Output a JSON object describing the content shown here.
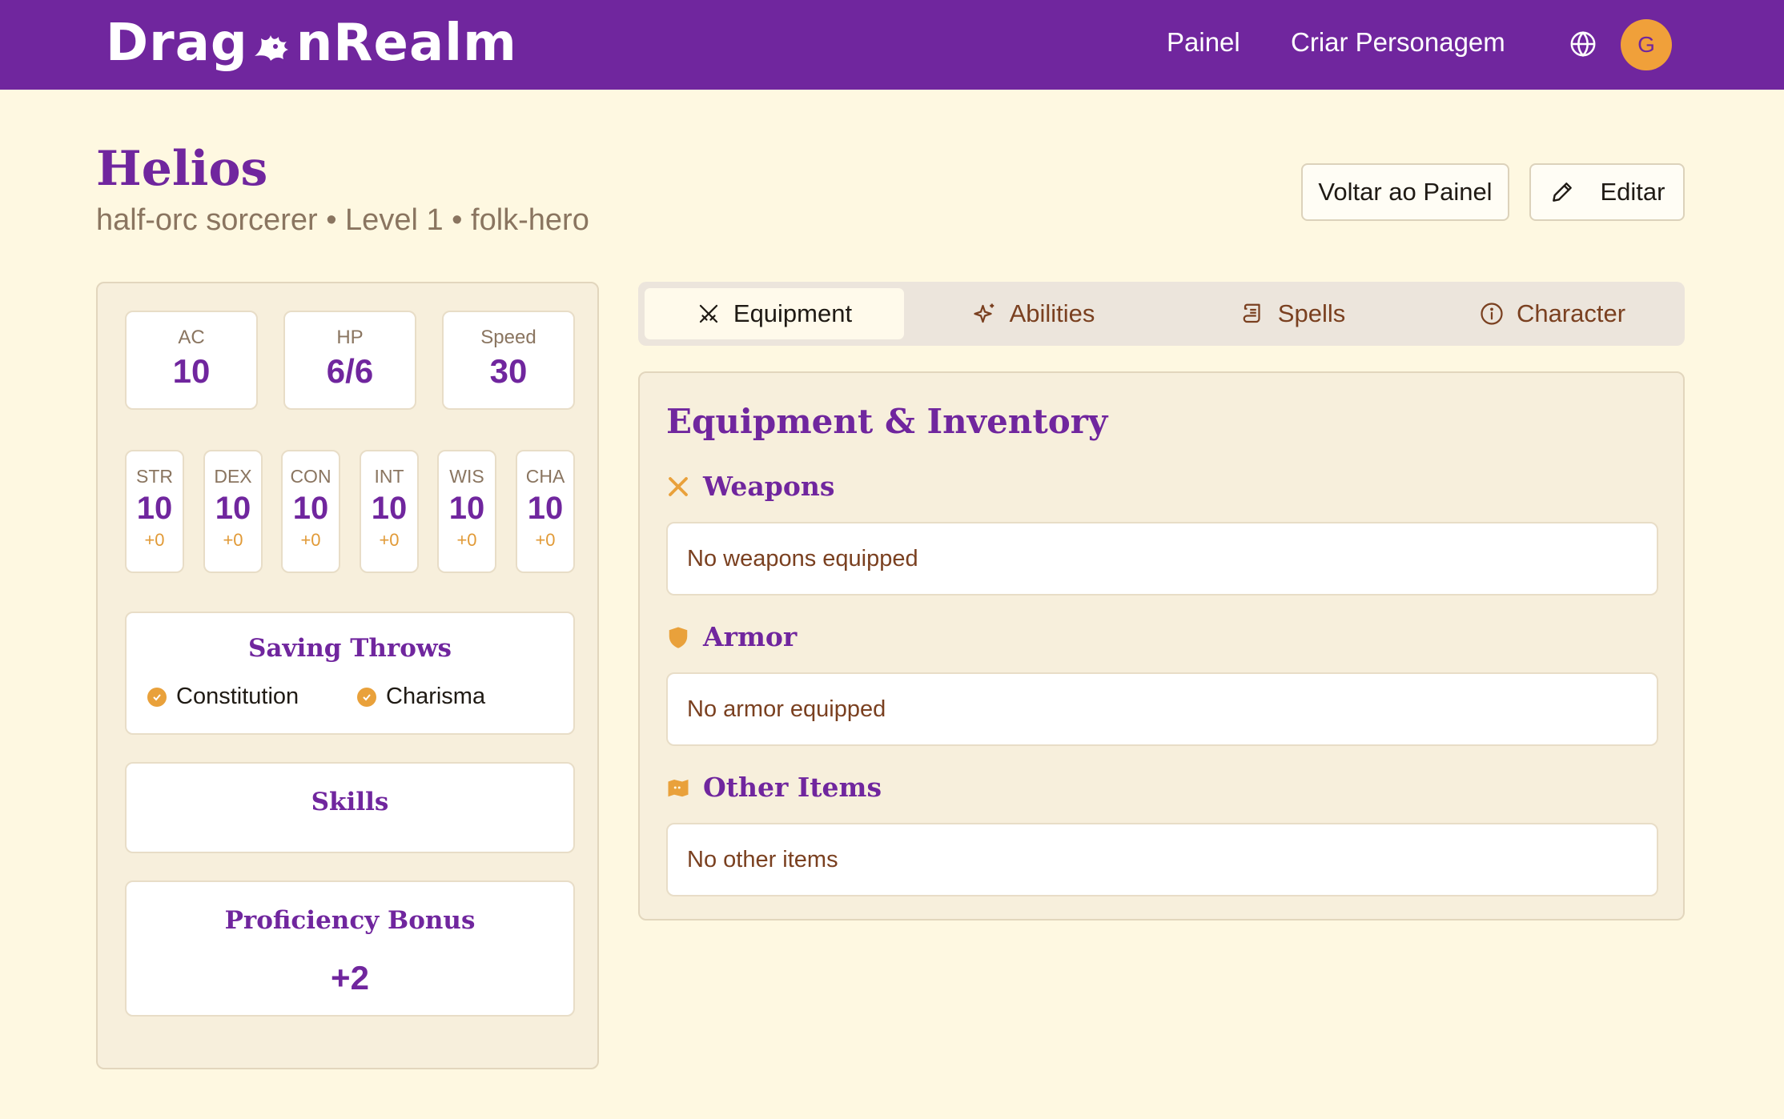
{
  "header": {
    "brand_prefix": "Drag",
    "brand_suffix": "nRealm",
    "nav": {
      "painel": "Painel",
      "criar": "Criar Personagem"
    },
    "avatar_initial": "G",
    "icons": {
      "logo": "dragon-head-icon",
      "language": "globe-icon"
    },
    "colors": {
      "bar": "#70269e",
      "avatar": "#f0a03a"
    }
  },
  "character": {
    "name": "Helios",
    "subtitle": "half-orc sorcerer • Level 1 • folk-hero"
  },
  "actions": {
    "back": "Voltar ao Painel",
    "edit": "Editar",
    "edit_icon": "pencil-icon"
  },
  "stats": {
    "ac": {
      "label": "AC",
      "value": "10"
    },
    "hp": {
      "label": "HP",
      "value": "6/6"
    },
    "speed": {
      "label": "Speed",
      "value": "30"
    }
  },
  "abilities": [
    {
      "label": "STR",
      "value": "10",
      "mod": "+0"
    },
    {
      "label": "DEX",
      "value": "10",
      "mod": "+0"
    },
    {
      "label": "CON",
      "value": "10",
      "mod": "+0"
    },
    {
      "label": "INT",
      "value": "10",
      "mod": "+0"
    },
    {
      "label": "WIS",
      "value": "10",
      "mod": "+0"
    },
    {
      "label": "CHA",
      "value": "10",
      "mod": "+0"
    }
  ],
  "saving_throws": {
    "title": "Saving Throws",
    "items": [
      "Constitution",
      "Charisma"
    ]
  },
  "skills": {
    "title": "Skills"
  },
  "proficiency": {
    "title": "Proficiency Bonus",
    "value": "+2"
  },
  "tabs": [
    {
      "label": "Equipment",
      "icon": "crossed-swords-icon",
      "active": true
    },
    {
      "label": "Abilities",
      "icon": "sparkles-icon",
      "active": false
    },
    {
      "label": "Spells",
      "icon": "scroll-icon",
      "active": false
    },
    {
      "label": "Character",
      "icon": "info-icon",
      "active": false
    }
  ],
  "equipment": {
    "title": "Equipment & Inventory",
    "groups": [
      {
        "title": "Weapons",
        "icon": "crossed-swords-icon",
        "empty": "No weapons equipped"
      },
      {
        "title": "Armor",
        "icon": "shield-icon",
        "empty": "No armor equipped"
      },
      {
        "title": "Other Items",
        "icon": "backpack-icon",
        "empty": "No other items"
      }
    ]
  },
  "colors": {
    "accent": "#70269e",
    "orange": "#e9a13b",
    "background": "#fef8e1"
  }
}
